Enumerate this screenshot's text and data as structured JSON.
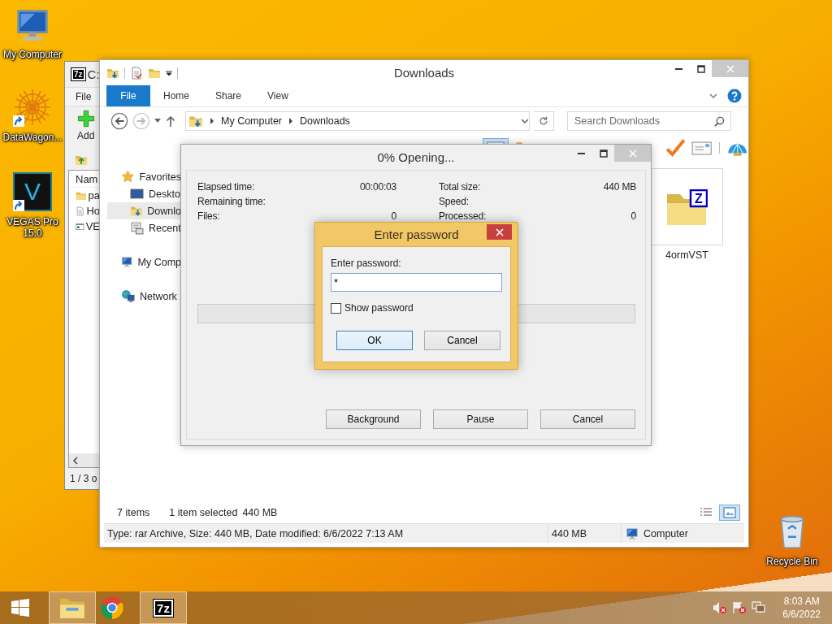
{
  "desktop_icons": [
    {
      "kind": "computer",
      "label": "My Computer",
      "shortcut": false
    },
    {
      "kind": "mandala",
      "label": "DataWagon...",
      "shortcut": true
    },
    {
      "kind": "app-logo",
      "logo_text": "V",
      "label": "VEGAS Pro 15.0",
      "shortcut": true
    }
  ],
  "recycle_bin": {
    "label": "Recycle Bin"
  },
  "archive_window": {
    "logo_text": "7z",
    "title": "C:",
    "menu": [
      "File"
    ],
    "toolbar": [
      {
        "kind": "add",
        "label": "Add"
      }
    ],
    "column": "Nam",
    "rows": [
      {
        "kind": "folder",
        "name": "pa"
      },
      {
        "kind": "text",
        "name": "Ho"
      },
      {
        "kind": "program",
        "name": "VE"
      }
    ],
    "status": "1 / 3 o"
  },
  "explorer": {
    "title": "Downloads",
    "ribbon_tabs": [
      {
        "label": "File",
        "kind": "file-menu"
      },
      {
        "label": "Home",
        "kind": "tab"
      },
      {
        "label": "Share",
        "kind": "tab"
      },
      {
        "label": "View",
        "kind": "tab"
      }
    ],
    "breadcrumb": [
      "My Computer",
      "Downloads"
    ],
    "search": {
      "placeholder": "Search Downloads"
    },
    "nav": [
      {
        "label": "Favorites",
        "kind": "favorites",
        "selected": false,
        "children": [
          {
            "label": "Deskto",
            "kind": "desktop",
            "selected": false
          },
          {
            "label": "Downlo",
            "kind": "downloads",
            "selected": true
          },
          {
            "label": "Recent",
            "kind": "recent",
            "selected": false
          }
        ]
      },
      {
        "label": "My Comp",
        "kind": "computer",
        "selected": false
      },
      {
        "label": "Network",
        "kind": "network",
        "selected": false
      }
    ],
    "files": [
      {
        "name": "4ormVST",
        "icon_letter": "Z",
        "selected": true
      }
    ],
    "status": {
      "count": "7 items",
      "selection": "1 item selected",
      "selection_size": "440 MB"
    },
    "details": {
      "info": "Type: rar Archive, Size: 440 MB, Date modified: 6/6/2022 7:13 AM",
      "size": "440 MB",
      "location": "Computer"
    }
  },
  "progress_dialog": {
    "title": "0% Opening...",
    "stats_left": [
      {
        "label": "Elapsed time:",
        "value": "00:00:03"
      },
      {
        "label": "Remaining time:"
      },
      {
        "label": "Files:",
        "value": "0"
      }
    ],
    "stats_right": [
      {
        "label": "Total size:",
        "value": "440 MB"
      },
      {
        "label": "Speed:"
      },
      {
        "label": "Processed:",
        "value": "0"
      }
    ],
    "progress": {
      "level": 0
    },
    "buttons": [
      "Background",
      "Pause",
      "Cancel"
    ]
  },
  "password_dialog": {
    "title": "Enter password",
    "prompt": "Enter password:",
    "value": "*",
    "show_password": {
      "label": "Show password",
      "checked": false
    },
    "buttons": [
      {
        "label": "OK",
        "focused": true
      },
      {
        "label": "Cancel",
        "focused": false
      }
    ]
  },
  "taskbar": {
    "apps": [
      {
        "kind": "explorer",
        "selected": true
      },
      {
        "kind": "chrome",
        "selected": false
      },
      {
        "kind": "archiver",
        "logo_text": "7z",
        "selected": true
      }
    ],
    "clock": {
      "time": "8:03 AM",
      "date": "6/6/2022"
    }
  }
}
